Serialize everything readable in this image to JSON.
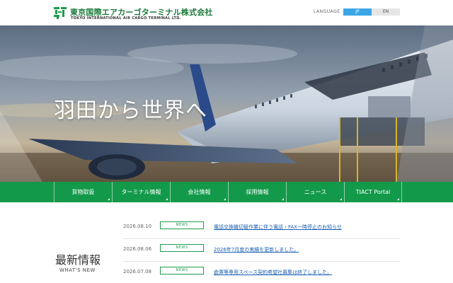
{
  "header": {
    "company_jp": "東京国際エアカーゴターミナル株式会社",
    "company_en": "TOKYO INTERNATIONAL AIR CARGO TERMINAL LTD.",
    "language_label": "LANGUAGE",
    "lang_jp": "JP",
    "lang_en": "EN",
    "brand_color": "#129a4a",
    "active_lang_color": "#3aa6e6"
  },
  "hero": {
    "title": "羽田から世界へ"
  },
  "nav": {
    "items": [
      {
        "label": "貨物取扱"
      },
      {
        "label": "ターミナル情報"
      },
      {
        "label": "会社情報"
      },
      {
        "label": "採用情報"
      },
      {
        "label": "ニュース"
      },
      {
        "label": "TIACT Portal"
      }
    ]
  },
  "news": {
    "heading": "最新情報",
    "subheading": "WHAT'S NEW",
    "items": [
      {
        "date": "2026.08.10",
        "badge": "NEWS",
        "title": "電話交換機切替作業に伴う電話・FAX一時停止のお知らせ"
      },
      {
        "date": "2026.08.06",
        "badge": "NEWS",
        "title": "2026年7月度の実績を更新しました。"
      },
      {
        "date": "2026.07.08",
        "badge": "NEWS",
        "title": "倉庫等専用スペース契約希望社募集は終了しました。"
      }
    ]
  }
}
